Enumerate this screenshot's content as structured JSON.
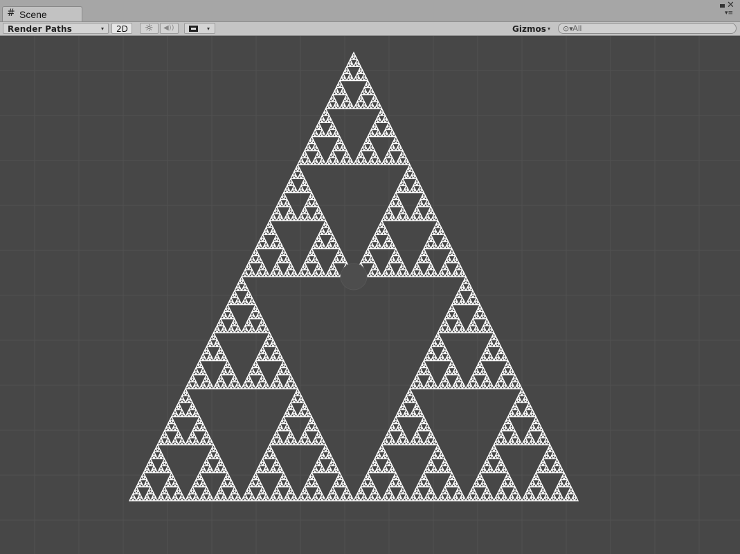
{
  "window": {
    "tab_label": "Scene",
    "tab_icon": "#",
    "close_glyph": "✕",
    "menu_glyph": "▾≡"
  },
  "toolbar": {
    "render_mode": "Render Paths",
    "dropdown_caret": "▾",
    "mode_2d_label": "2D",
    "lighting_glyph": "☼",
    "audio_glyph": "◀))",
    "effects_glyph": "▬",
    "gizmos_label": "Gizmos",
    "search_icon_glyph": "⊙▾",
    "search_placeholder": "All"
  },
  "scene": {
    "background_color": "#474747",
    "grid_color": "#525252",
    "fractal_color": "#ffffff",
    "fractal_type": "Sierpinski triangle",
    "recursion_depth": 7
  }
}
